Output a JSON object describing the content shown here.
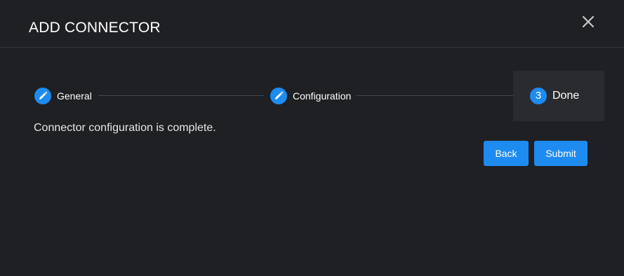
{
  "dialog": {
    "title": "ADD CONNECTOR",
    "close_icon": "close-icon"
  },
  "stepper": {
    "steps": [
      {
        "label": "General",
        "icon": "pencil-icon",
        "state": "completed"
      },
      {
        "label": "Configuration",
        "icon": "pencil-icon",
        "state": "completed"
      },
      {
        "label": "Done",
        "number": "3",
        "state": "active"
      }
    ]
  },
  "content": {
    "message": "Connector configuration is complete."
  },
  "actions": {
    "back_label": "Back",
    "submit_label": "Submit"
  },
  "colors": {
    "background": "#1f2023",
    "accent": "#1e8bf0",
    "active_step_bg": "#2a2b2e",
    "divider": "#34363a"
  }
}
